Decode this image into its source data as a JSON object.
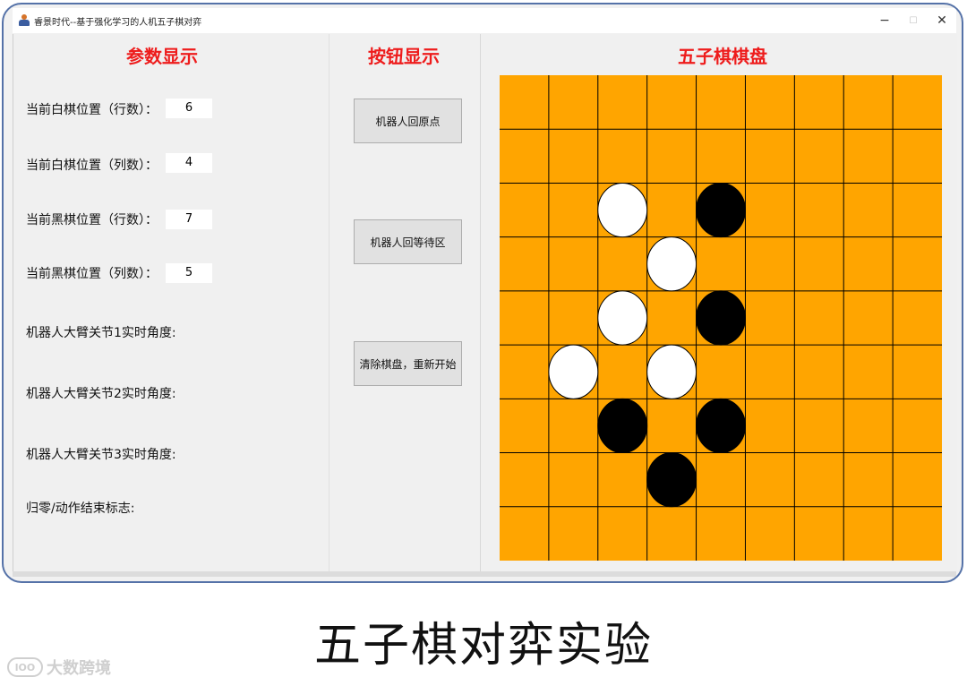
{
  "window": {
    "title": "睿景时代--基于强化学习的人机五子棋对弈",
    "app_icon": "person-figure-icon",
    "controls": {
      "minimize": "−",
      "maximize": "☐",
      "close": "✕"
    }
  },
  "left_panel": {
    "title": "参数显示",
    "params": [
      {
        "label": "当前白棋位置（行数）：",
        "value": "6"
      },
      {
        "label": "当前白棋位置（列数）：",
        "value": "4"
      },
      {
        "label": "当前黑棋位置（行数）：",
        "value": "7"
      },
      {
        "label": "当前黑棋位置（列数）：",
        "value": "5"
      }
    ],
    "status": [
      {
        "label": "机器人大臂关节1实时角度:"
      },
      {
        "label": "机器人大臂关节2实时角度:"
      },
      {
        "label": "机器人大臂关节3实时角度:"
      },
      {
        "label": "归零/动作结束标志:"
      }
    ]
  },
  "middle_panel": {
    "title": "按钮显示",
    "buttons": [
      {
        "label": "机器人回原点"
      },
      {
        "label": "机器人回等待区"
      },
      {
        "label": "清除棋盘，重新开始"
      }
    ]
  },
  "right_panel": {
    "title": "五子棋棋盘",
    "board": {
      "columns": 9,
      "rows": 9,
      "board_color": "#FFA500",
      "line_color": "#000000",
      "pieces": [
        {
          "row": 2,
          "col": 2,
          "color": "white"
        },
        {
          "row": 2,
          "col": 4,
          "color": "black"
        },
        {
          "row": 3,
          "col": 3,
          "color": "white"
        },
        {
          "row": 4,
          "col": 2,
          "color": "white"
        },
        {
          "row": 4,
          "col": 4,
          "color": "black"
        },
        {
          "row": 5,
          "col": 1,
          "color": "white"
        },
        {
          "row": 5,
          "col": 3,
          "color": "white"
        },
        {
          "row": 6,
          "col": 2,
          "color": "black"
        },
        {
          "row": 6,
          "col": 4,
          "color": "black"
        },
        {
          "row": 7,
          "col": 3,
          "color": "black"
        }
      ]
    }
  },
  "caption": "五子棋对弈实验",
  "watermark": {
    "logo": "lOO",
    "text": "大数跨境"
  },
  "colors": {
    "title_red": "#EE1C1C",
    "frame_border": "#5572A8"
  }
}
